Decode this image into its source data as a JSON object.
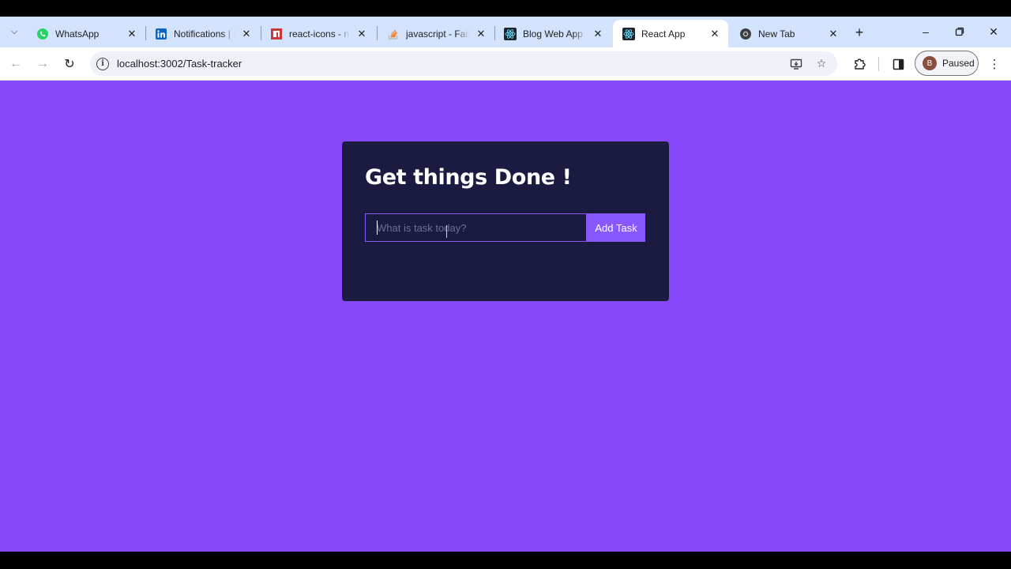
{
  "browser": {
    "tabs": [
      {
        "title": "WhatsApp",
        "icon": "whatsapp-icon",
        "color": "#25d366",
        "active": false
      },
      {
        "title": "Notifications | LinkedIn",
        "icon": "linkedin-icon",
        "color": "#0a66c2",
        "active": false
      },
      {
        "title": "react-icons - npm",
        "icon": "npm-icon",
        "color": "#cb3837",
        "active": false
      },
      {
        "title": "javascript - Failed",
        "icon": "stackoverflow-icon",
        "color": "#f48024",
        "active": false
      },
      {
        "title": "Blog Web App",
        "icon": "react-icon",
        "color": "#20232a",
        "active": false
      },
      {
        "title": "React App",
        "icon": "react-icon",
        "color": "#20232a",
        "active": true
      },
      {
        "title": "New Tab",
        "icon": "chrome-icon",
        "color": "#4285f4",
        "active": false
      }
    ],
    "address_bar": {
      "url": "localhost:3002/Task-tracker"
    },
    "profile": {
      "initial": "B",
      "status": "Paused"
    }
  },
  "app": {
    "heading": "Get things Done !",
    "task_input": {
      "placeholder": "What is task today?",
      "value": ""
    },
    "add_button_label": "Add Task"
  },
  "colors": {
    "page_background": "#8548fa",
    "card_background": "#1b1a41",
    "accent": "#8758ff"
  }
}
